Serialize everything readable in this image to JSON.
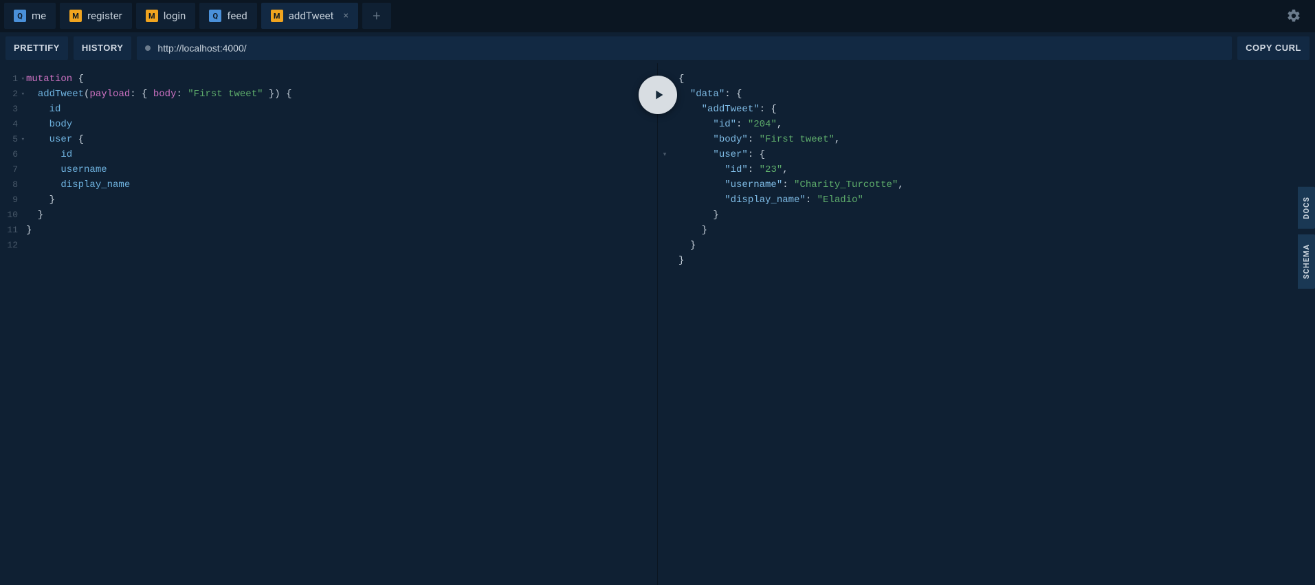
{
  "tabs": [
    {
      "badge": "Q",
      "label": "me",
      "active": false
    },
    {
      "badge": "M",
      "label": "register",
      "active": false
    },
    {
      "badge": "M",
      "label": "login",
      "active": false
    },
    {
      "badge": "Q",
      "label": "feed",
      "active": false
    },
    {
      "badge": "M",
      "label": "addTweet",
      "active": true
    }
  ],
  "toolbar": {
    "prettify": "PRETTIFY",
    "history": "HISTORY",
    "endpoint": "http://localhost:4000/",
    "copy_curl": "COPY CURL"
  },
  "rail": {
    "docs": "DOCS",
    "schema": "SCHEMA"
  },
  "query": {
    "line_count": 12,
    "lines": {
      "l1": "mutation",
      "l1b": " {",
      "l2a": "  ",
      "l2b": "addTweet",
      "l2c": "(",
      "l2d": "payload",
      "l2e": ": { ",
      "l2f": "body",
      "l2g": ": ",
      "l2h": "\"First tweet\"",
      "l2i": " }) {",
      "l3": "    id",
      "l4": "    body",
      "l5a": "    ",
      "l5b": "user",
      "l5c": " {",
      "l6": "      id",
      "l7": "      username",
      "l8": "      display_name",
      "l9": "    }",
      "l10": "  }",
      "l11": "}"
    }
  },
  "response": {
    "data": {
      "addTweet": {
        "id": "204",
        "body": "First tweet",
        "user": {
          "id": "23",
          "username": "Charity_Turcotte",
          "display_name": "Eladio"
        }
      }
    },
    "labels": {
      "data": "\"data\"",
      "addTweet": "\"addTweet\"",
      "id": "\"id\"",
      "id_v": "\"204\"",
      "body": "\"body\"",
      "body_v": "\"First tweet\"",
      "user": "\"user\"",
      "uid": "\"id\"",
      "uid_v": "\"23\"",
      "uname": "\"username\"",
      "uname_v": "\"Charity_Turcotte\"",
      "dname": "\"display_name\"",
      "dname_v": "\"Eladio\""
    }
  }
}
